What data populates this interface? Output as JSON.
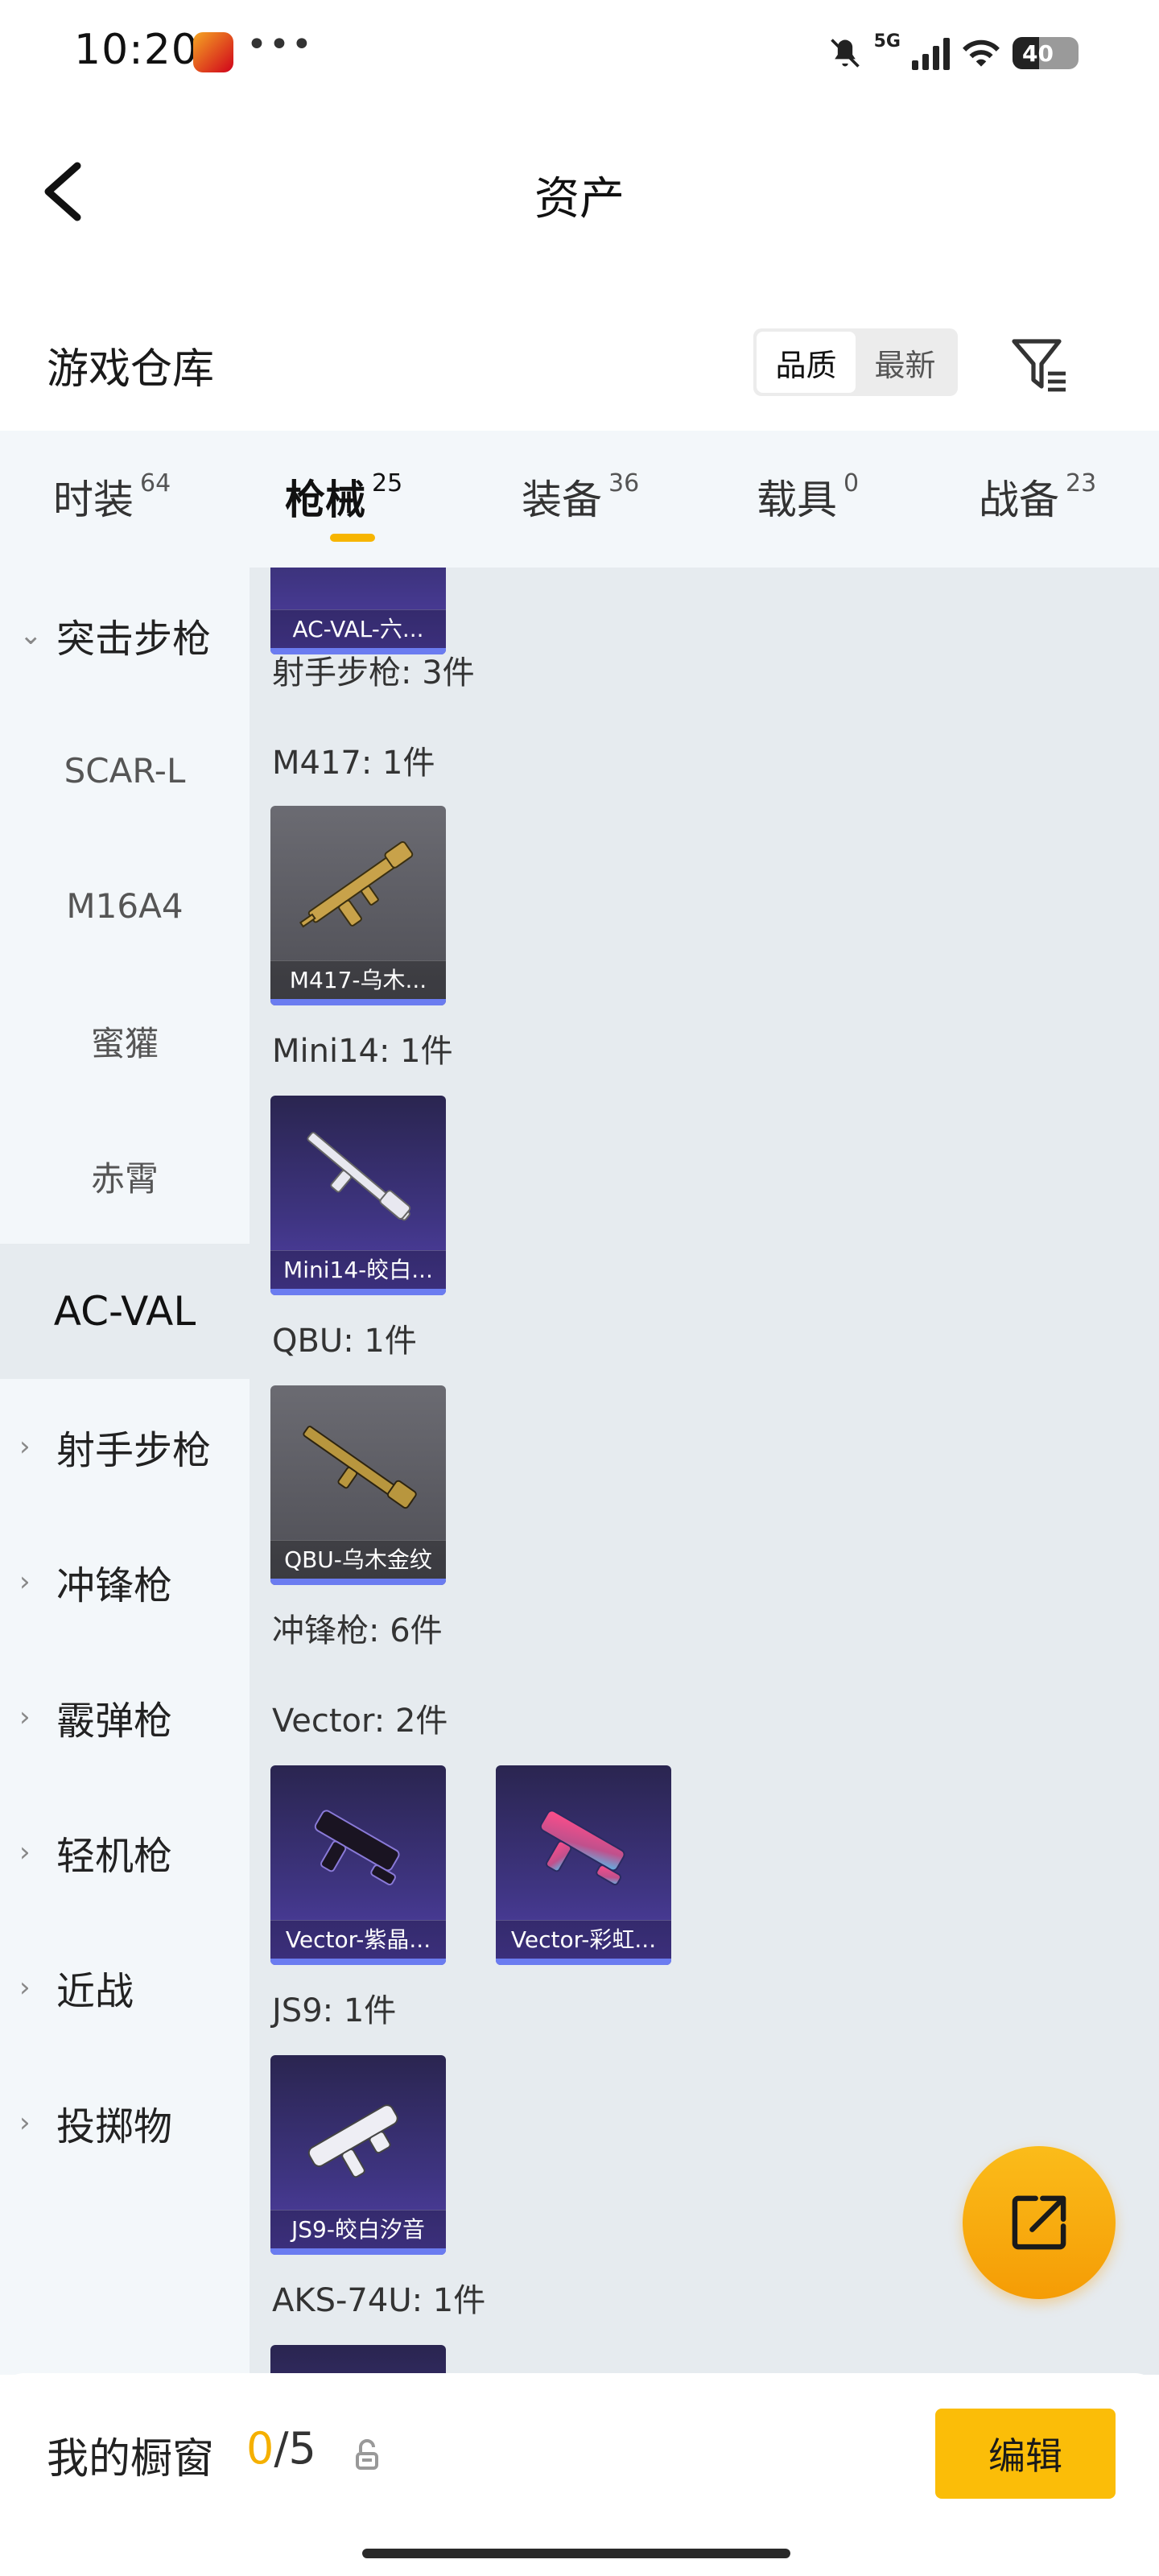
{
  "status_bar": {
    "time": "10:20",
    "dots": "•••",
    "network": "5G",
    "battery": "40"
  },
  "header": {
    "title": "资产"
  },
  "warehouse": {
    "title": "游戏仓库",
    "sort_options": [
      "品质",
      "最新"
    ],
    "sort_selected": "品质"
  },
  "tabs": [
    {
      "label": "时装",
      "count": "64"
    },
    {
      "label": "枪械",
      "count": "25"
    },
    {
      "label": "装备",
      "count": "36"
    },
    {
      "label": "载具",
      "count": "0"
    },
    {
      "label": "战备",
      "count": "23"
    }
  ],
  "sidebar": {
    "items": [
      {
        "label": "突击步枪"
      },
      {
        "label": "SCAR-L"
      },
      {
        "label": "M16A4"
      },
      {
        "label": "蜜獾"
      },
      {
        "label": "赤霄"
      },
      {
        "label": "AC-VAL"
      },
      {
        "label": "射手步枪"
      },
      {
        "label": "冲锋枪"
      },
      {
        "label": "霰弹枪"
      },
      {
        "label": "轻机枪"
      },
      {
        "label": "近战"
      },
      {
        "label": "投掷物"
      }
    ]
  },
  "content": {
    "labels": {
      "marksman": "射手步枪: 3件",
      "m417": "M417: 1件",
      "mini14": "Mini14: 1件",
      "qbu": "QBU: 1件",
      "smg": "冲锋枪: 6件",
      "vector": "Vector: 2件",
      "js9": "JS9: 1件",
      "aks": "AKS-74U: 1件"
    },
    "cards": {
      "acval": "AC-VAL-六...",
      "m417": "M417-乌木...",
      "mini14": "Mini14-皎白...",
      "qbu": "QBU-乌木金纹",
      "vector1": "Vector-紫晶...",
      "vector2": "Vector-彩虹...",
      "js9": "JS9-皎白汐音"
    }
  },
  "bottom": {
    "showcase_label": "我的橱窗",
    "showcase_current": "0",
    "showcase_total": "/5",
    "edit_label": "编辑"
  }
}
